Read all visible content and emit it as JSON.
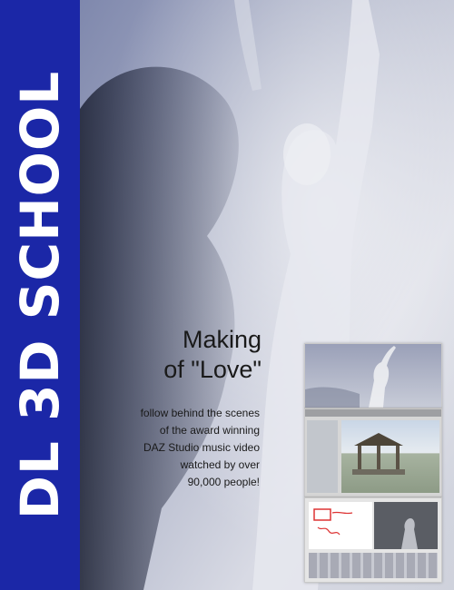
{
  "brand": {
    "text": "DL 3D SCHOOL"
  },
  "headline": {
    "line1": "Making",
    "line2": "of \"Love\""
  },
  "description": {
    "lines": [
      "follow behind the scenes",
      "of the award winning",
      "DAZ Studio music video",
      "watched by over",
      "90,000 people!"
    ]
  },
  "colors": {
    "sidebar": "#1b27a7",
    "text": "#1a1a1a",
    "brand_text": "#ffffff"
  }
}
